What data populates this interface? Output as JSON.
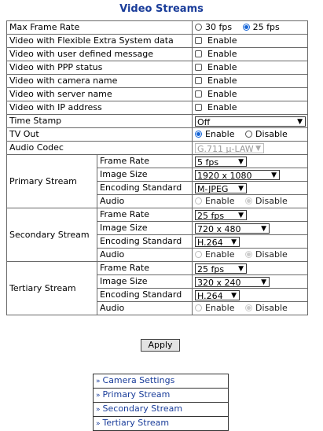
{
  "page_title": "Video Streams",
  "rows": {
    "max_frame_rate": {
      "label": "Max Frame Rate",
      "opt1": "30 fps",
      "opt2": "25 fps",
      "selected": "25 fps"
    },
    "flex_extra": {
      "label": "Video with Flexible Extra System data",
      "check_label": "Enable"
    },
    "user_msg": {
      "label": "Video with user defined message",
      "check_label": "Enable"
    },
    "ppp_status": {
      "label": "Video with PPP status",
      "check_label": "Enable"
    },
    "camera_name": {
      "label": "Video with camera name",
      "check_label": "Enable"
    },
    "server_name": {
      "label": "Video with server name",
      "check_label": "Enable"
    },
    "ip_address": {
      "label": "Video with IP address",
      "check_label": "Enable"
    },
    "time_stamp": {
      "label": "Time Stamp",
      "value": "Off"
    },
    "tv_out": {
      "label": "TV Out",
      "opt1": "Enable",
      "opt2": "Disable",
      "selected": "Enable"
    },
    "audio_codec": {
      "label": "Audio Codec",
      "value": "G.711 μ-LAW"
    }
  },
  "streams": {
    "primary": {
      "label": "Primary Stream",
      "frame_rate_label": "Frame Rate",
      "frame_rate": "5 fps",
      "image_size_label": "Image Size",
      "image_size": "1920 x 1080",
      "encoding_label": "Encoding Standard",
      "encoding": "M-JPEG",
      "audio_label": "Audio",
      "audio_opt1": "Enable",
      "audio_opt2": "Disable"
    },
    "secondary": {
      "label": "Secondary Stream",
      "frame_rate_label": "Frame Rate",
      "frame_rate": "25 fps",
      "image_size_label": "Image Size",
      "image_size": "720 x 480",
      "encoding_label": "Encoding Standard",
      "encoding": "H.264",
      "audio_label": "Audio",
      "audio_opt1": "Enable",
      "audio_opt2": "Disable"
    },
    "tertiary": {
      "label": "Tertiary Stream",
      "frame_rate_label": "Frame Rate",
      "frame_rate": "25 fps",
      "image_size_label": "Image Size",
      "image_size": "320 x 240",
      "encoding_label": "Encoding Standard",
      "encoding": "H.264",
      "audio_label": "Audio",
      "audio_opt1": "Enable",
      "audio_opt2": "Disable"
    }
  },
  "apply_label": "Apply",
  "links": [
    "Camera Settings",
    "Primary Stream",
    "Secondary Stream",
    "Tertiary Stream"
  ],
  "colors": {
    "title": "#1a3d9a",
    "link": "#1a3d9a",
    "radio_selected": "#1565d8"
  }
}
